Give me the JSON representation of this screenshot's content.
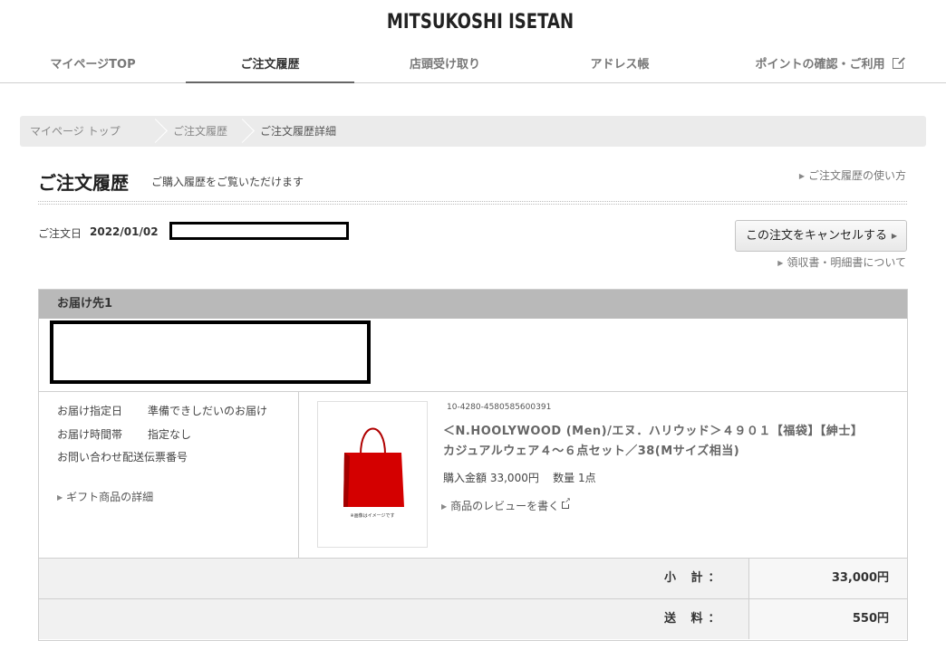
{
  "brand": {
    "logo": "MITSUKOSHI ISETAN"
  },
  "nav": {
    "items": [
      {
        "label": "マイページTOP"
      },
      {
        "label": "ご注文履歴"
      },
      {
        "label": "店頭受け取り"
      },
      {
        "label": "アドレス帳"
      },
      {
        "label": "ポイントの確認・ご利用"
      }
    ],
    "active_index": 1
  },
  "breadcrumb": [
    "マイページ トップ",
    "ご注文履歴",
    "ご注文履歴詳細"
  ],
  "page": {
    "title": "ご注文履歴",
    "subtitle": "ご購入履歴をご覧いただけます",
    "help_link": "ご注文履歴の使い方"
  },
  "order": {
    "date_label": "ご注文日",
    "date_value": "2022/01/02",
    "cancel_button": "この注文をキャンセルする",
    "receipt_link": "領収書・明細書について"
  },
  "delivery": {
    "header": "お届け先1",
    "fields": [
      {
        "label": "お届け指定日",
        "value": "準備できしだいのお届け"
      },
      {
        "label": "お届け時間帯",
        "value": "指定なし"
      },
      {
        "label": "お問い合わせ配送伝票番号",
        "value": ""
      }
    ],
    "gift_link": "ギフト商品の詳細"
  },
  "item": {
    "image_caption": "※画像はイメージです",
    "sku": "10-4280-4580585600391",
    "name": "＜N.HOOLYWOOD (Men)/エヌ．ハリウッド＞４９０１【福袋】【紳士】カジュアルウェア４～６点セット／38(Mサイズ相当)",
    "price_label": "購入金額",
    "price": "33,000円",
    "qty_label": "数量",
    "qty": "1点",
    "review_link": "商品のレビューを書く"
  },
  "summary": [
    {
      "label": "小 計：",
      "value": "33,000円"
    },
    {
      "label": "送 料：",
      "value": "550円"
    }
  ],
  "colors": {
    "bag_red": "#d40000",
    "header_gray": "#b9b9b9",
    "breadcrumb_bg": "#ebebeb"
  },
  "icons": {
    "external": "external-link-icon",
    "arrow": "triangle-right-icon"
  }
}
